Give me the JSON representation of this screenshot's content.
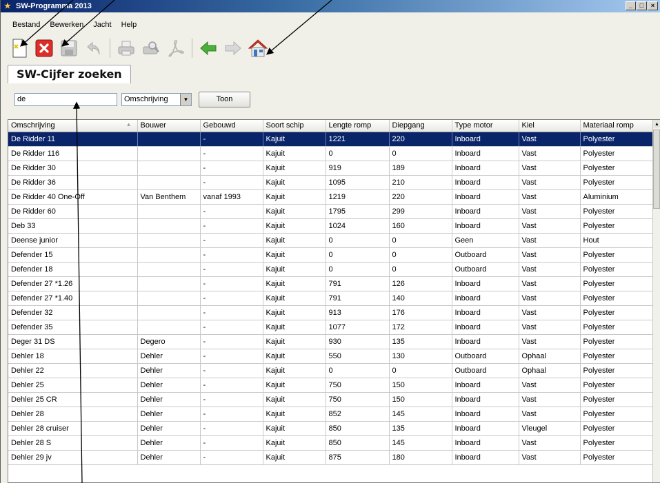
{
  "window": {
    "title": "SW-Programma 2013",
    "controls": [
      "_",
      "□",
      "×"
    ]
  },
  "menu": [
    {
      "label": "Bestand"
    },
    {
      "label": "Bewerken"
    },
    {
      "label": "Jacht"
    },
    {
      "label": "Help"
    }
  ],
  "toolbar": {
    "icons": [
      "new-icon",
      "delete-icon",
      "save-icon",
      "undo-icon",
      "print-icon",
      "print-preview-icon",
      "pdf-icon",
      "back-icon",
      "forward-icon",
      "home-icon"
    ],
    "colors": {
      "delete": "#d9302c",
      "arrow": "#4caf3a",
      "home_roof": "#d93a2b"
    }
  },
  "tab": {
    "label": "SW-Cijfer zoeken"
  },
  "search": {
    "value": "de",
    "field_selected": "Omschrijving",
    "button_label": "Toon"
  },
  "table": {
    "columns": [
      "Omschrijving",
      "Bouwer",
      "Gebouwd",
      "Soort schip",
      "Lengte romp",
      "Diepgang",
      "Type motor",
      "Kiel",
      "Materiaal romp"
    ],
    "selected_row": 0,
    "selection_color": "#0a246a",
    "rows": [
      [
        "De Ridder 11",
        "",
        "-",
        "Kajuit",
        "1221",
        "220",
        "Inboard",
        "Vast",
        "Polyester"
      ],
      [
        "De Ridder 116",
        "",
        "-",
        "Kajuit",
        "0",
        "0",
        "Inboard",
        "Vast",
        "Polyester"
      ],
      [
        "De Ridder 30",
        "",
        "-",
        "Kajuit",
        "919",
        "189",
        "Inboard",
        "Vast",
        "Polyester"
      ],
      [
        "De Ridder 36",
        "",
        "-",
        "Kajuit",
        "1095",
        "210",
        "Inboard",
        "Vast",
        "Polyester"
      ],
      [
        "De Ridder 40 One-Off",
        "Van Benthem",
        "vanaf 1993",
        "Kajuit",
        "1219",
        "220",
        "Inboard",
        "Vast",
        "Aluminium"
      ],
      [
        "De Ridder 60",
        "",
        "-",
        "Kajuit",
        "1795",
        "299",
        "Inboard",
        "Vast",
        "Polyester"
      ],
      [
        "Deb 33",
        "",
        "-",
        "Kajuit",
        "1024",
        "160",
        "Inboard",
        "Vast",
        "Polyester"
      ],
      [
        "Deense junior",
        "",
        "-",
        "Kajuit",
        "0",
        "0",
        "Geen",
        "Vast",
        "Hout"
      ],
      [
        "Defender 15",
        "",
        "-",
        "Kajuit",
        "0",
        "0",
        "Outboard",
        "Vast",
        "Polyester"
      ],
      [
        "Defender 18",
        "",
        "-",
        "Kajuit",
        "0",
        "0",
        "Outboard",
        "Vast",
        "Polyester"
      ],
      [
        "Defender 27 *1.26",
        "",
        "-",
        "Kajuit",
        "791",
        "126",
        "Inboard",
        "Vast",
        "Polyester"
      ],
      [
        "Defender 27 *1.40",
        "",
        "-",
        "Kajuit",
        "791",
        "140",
        "Inboard",
        "Vast",
        "Polyester"
      ],
      [
        "Defender 32",
        "",
        "-",
        "Kajuit",
        "913",
        "176",
        "Inboard",
        "Vast",
        "Polyester"
      ],
      [
        "Defender 35",
        "",
        "-",
        "Kajuit",
        "1077",
        "172",
        "Inboard",
        "Vast",
        "Polyester"
      ],
      [
        "Deger 31 DS",
        "Degero",
        "-",
        "Kajuit",
        "930",
        "135",
        "Inboard",
        "Vast",
        "Polyester"
      ],
      [
        "Dehler 18",
        "Dehler",
        "-",
        "Kajuit",
        "550",
        "130",
        "Outboard",
        "Ophaal",
        "Polyester"
      ],
      [
        "Dehler 22",
        "Dehler",
        "-",
        "Kajuit",
        "0",
        "0",
        "Outboard",
        "Ophaal",
        "Polyester"
      ],
      [
        "Dehler 25",
        "Dehler",
        "-",
        "Kajuit",
        "750",
        "150",
        "Inboard",
        "Vast",
        "Polyester"
      ],
      [
        "Dehler 25 CR",
        "Dehler",
        "-",
        "Kajuit",
        "750",
        "150",
        "Inboard",
        "Vast",
        "Polyester"
      ],
      [
        "Dehler 28",
        "Dehler",
        "-",
        "Kajuit",
        "852",
        "145",
        "Inboard",
        "Vast",
        "Polyester"
      ],
      [
        "Dehler 28 cruiser",
        "Dehler",
        "-",
        "Kajuit",
        "850",
        "135",
        "Inboard",
        "Vleugel",
        "Polyester"
      ],
      [
        "Dehler 28 S",
        "Dehler",
        "-",
        "Kajuit",
        "850",
        "145",
        "Inboard",
        "Vast",
        "Polyester"
      ],
      [
        "Dehler 29 jv",
        "Dehler",
        "-",
        "Kajuit",
        "875",
        "180",
        "Inboard",
        "Vast",
        "Polyester"
      ]
    ]
  }
}
